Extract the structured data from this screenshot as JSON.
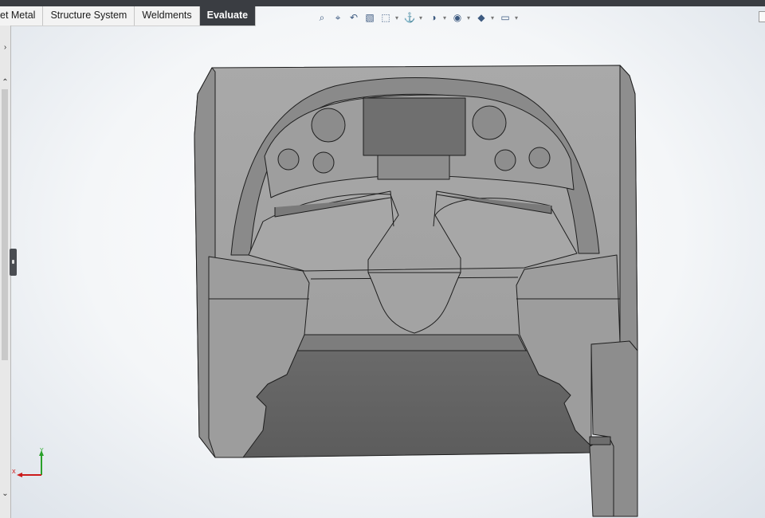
{
  "ribbon_tabs": [
    {
      "label": "et Metal",
      "active": false
    },
    {
      "label": "Structure System",
      "active": false
    },
    {
      "label": "Weldments",
      "active": false
    },
    {
      "label": "Evaluate",
      "active": true
    }
  ],
  "heads_up_toolbar": [
    {
      "icon": "zoom-to-fit-icon",
      "dropdown": false
    },
    {
      "icon": "zoom-to-area-icon",
      "dropdown": false
    },
    {
      "icon": "previous-view-icon",
      "dropdown": false
    },
    {
      "icon": "section-view-icon",
      "dropdown": false
    },
    {
      "icon": "view-orientation-icon",
      "dropdown": true
    },
    {
      "icon": "display-style-icon",
      "dropdown": true
    },
    {
      "icon": "hide-show-items-icon",
      "dropdown": true
    },
    {
      "icon": "edit-appearance-icon",
      "dropdown": true
    },
    {
      "icon": "apply-scene-icon",
      "dropdown": true
    },
    {
      "icon": "view-settings-icon",
      "dropdown": true
    }
  ],
  "triad": {
    "x_label": "X",
    "y_label": "Y"
  },
  "colors": {
    "ribbon_active_bg": "#3a3d42",
    "model_light": "#a8a8a8",
    "model_mid": "#8a8a8a",
    "model_dark": "#5f5f5f",
    "model_edge": "#202020"
  }
}
